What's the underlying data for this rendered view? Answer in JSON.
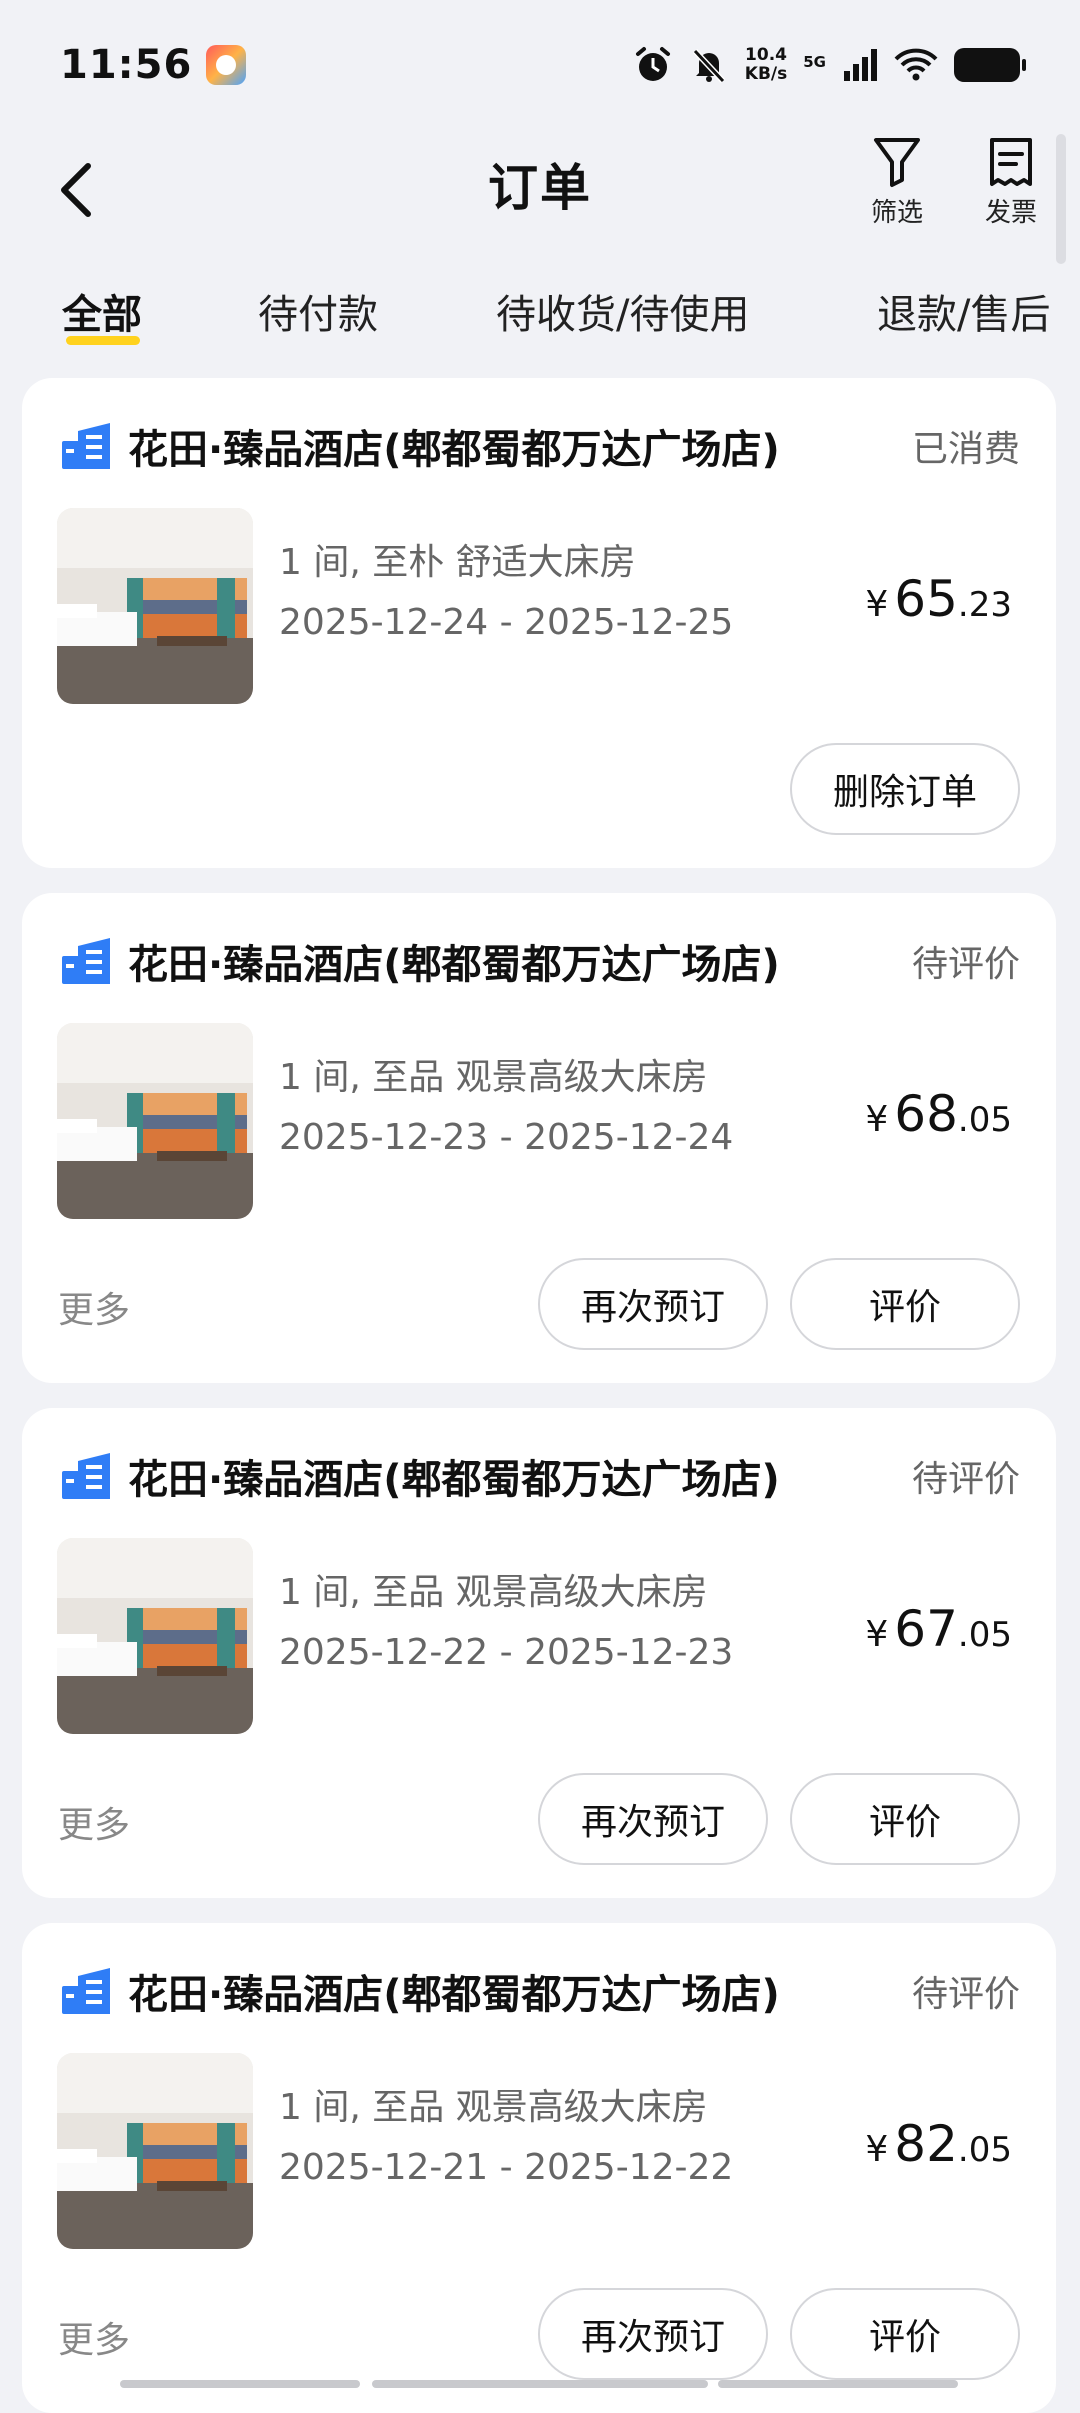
{
  "status_bar": {
    "time": "11:56",
    "net_speed_value": "10.4",
    "net_speed_unit": "KB/s",
    "network": "5G",
    "icons": [
      "alarm-icon",
      "mute-icon",
      "signal-icon",
      "wifi-icon",
      "battery-icon"
    ]
  },
  "header": {
    "title": "订单",
    "filter_label": "筛选",
    "invoice_label": "发票"
  },
  "tabs": [
    {
      "label": "全部",
      "active": true
    },
    {
      "label": "待付款",
      "active": false
    },
    {
      "label": "待收货/待使用",
      "active": false
    },
    {
      "label": "退款/售后",
      "active": false
    }
  ],
  "colors": {
    "accent": "#ffd21e",
    "hotel_icon": "#2f7df6",
    "background": "#f1f2f6"
  },
  "orders": [
    {
      "hotel": "花田·臻品酒店(郫都蜀都万达广场店)",
      "status": "已消费",
      "room": "1 间, 至朴 舒适大床房",
      "dates": "2025-12-24 - 2025-12-25",
      "currency": "¥",
      "price_int": "65",
      "price_dec": ".23",
      "more": "",
      "buttons": [
        "删除订单"
      ]
    },
    {
      "hotel": "花田·臻品酒店(郫都蜀都万达广场店)",
      "status": "待评价",
      "room": "1 间, 至品 观景高级大床房",
      "dates": "2025-12-23 - 2025-12-24",
      "currency": "¥",
      "price_int": "68",
      "price_dec": ".05",
      "more": "更多",
      "buttons": [
        "再次预订",
        "评价"
      ]
    },
    {
      "hotel": "花田·臻品酒店(郫都蜀都万达广场店)",
      "status": "待评价",
      "room": "1 间, 至品 观景高级大床房",
      "dates": "2025-12-22 - 2025-12-23",
      "currency": "¥",
      "price_int": "67",
      "price_dec": ".05",
      "more": "更多",
      "buttons": [
        "再次预订",
        "评价"
      ]
    },
    {
      "hotel": "花田·臻品酒店(郫都蜀都万达广场店)",
      "status": "待评价",
      "room": "1 间, 至品 观景高级大床房",
      "dates": "2025-12-21 - 2025-12-22",
      "currency": "¥",
      "price_int": "82",
      "price_dec": ".05",
      "more": "更多",
      "buttons": [
        "再次预订",
        "评价"
      ]
    }
  ]
}
